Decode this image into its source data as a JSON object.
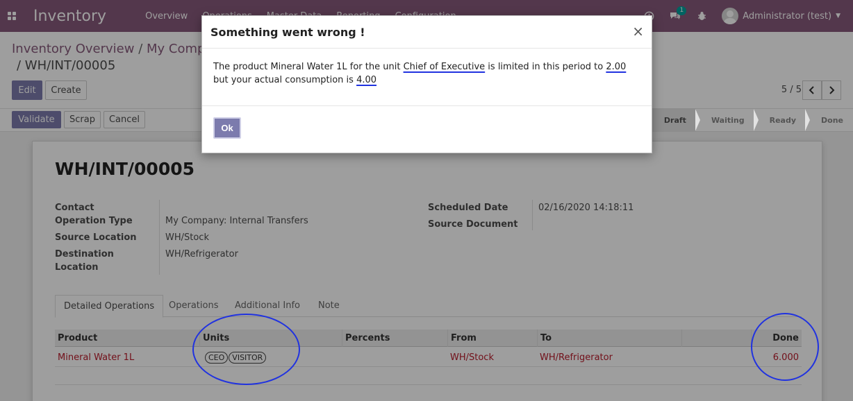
{
  "navbar": {
    "app_name": "Inventory",
    "menus": [
      "Overview",
      "Operations",
      "Master Data",
      "Reporting",
      "Configuration"
    ],
    "chat_count": "1",
    "user_name": "Administrator (test)"
  },
  "breadcrumb": {
    "parent": "Inventory Overview",
    "separator": "/",
    "middle": "My Company: Internal Transfers",
    "current": "/ WH/INT/00005"
  },
  "buttons": {
    "edit": "Edit",
    "create": "Create",
    "validate": "Validate",
    "scrap": "Scrap",
    "cancel": "Cancel"
  },
  "pager": {
    "value": "5 / 5"
  },
  "status_steps": [
    "Draft",
    "Waiting",
    "Ready",
    "Done"
  ],
  "record": {
    "title": "WH/INT/00005",
    "fields": {
      "contact_label": "Contact",
      "operation_type_label": "Operation Type",
      "operation_type_value": "My Company: Internal Transfers",
      "source_location_label": "Source Location",
      "source_location_value": "WH/Stock",
      "destination_label_1": "Destination",
      "destination_label_2": "Location",
      "destination_value": "WH/Refrigerator",
      "scheduled_date_label": "Scheduled Date",
      "scheduled_date_value": "02/16/2020 14:18:11",
      "source_document_label": "Source Document"
    },
    "tabs": [
      "Detailed Operations",
      "Operations",
      "Additional Info",
      "Note"
    ],
    "table": {
      "columns": [
        "Product",
        "Units",
        "Percents",
        "From",
        "To",
        "Done"
      ],
      "row": {
        "product": "Mineral Water 1L",
        "units": [
          "CEO",
          "VISITOR"
        ],
        "from": "WH/Stock",
        "to": "WH/Refrigerator",
        "done": "6.000"
      }
    }
  },
  "dialog": {
    "title": "Something went wrong !",
    "close": "×",
    "msg_1": "The product Mineral Water 1L for the unit ",
    "unit": "Chief of Executive",
    "msg_2": " is limited in this period to ",
    "limit": "2.00",
    "msg_3": " but your actual consumption is ",
    "consumption": "4.00",
    "ok": "Ok"
  },
  "colors": {
    "brand": "#875a7b",
    "primary_button": "#7c7bad",
    "annotation": "#2032e0",
    "link_red": "#b81b2a"
  }
}
